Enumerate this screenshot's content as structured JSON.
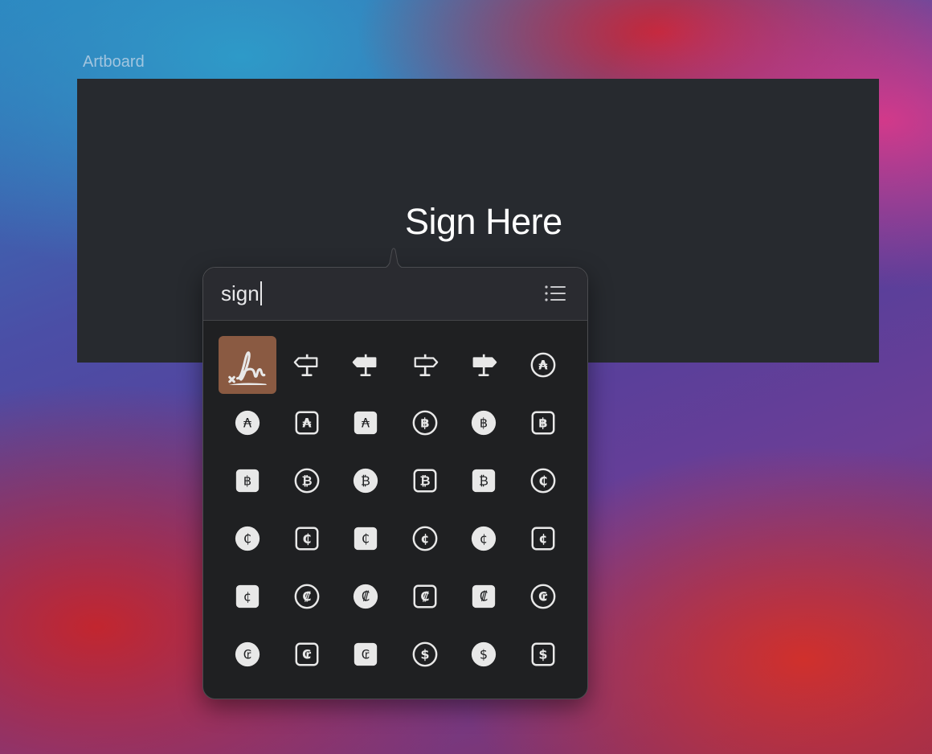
{
  "artboard": {
    "label": "Artboard",
    "text": "Sign Here"
  },
  "search": {
    "value": "sign"
  },
  "colors": {
    "selected_cell": "#8a5a42",
    "glyph": "#e8e8e8",
    "panel": "#1f2022"
  },
  "symbols": [
    {
      "name": "signature",
      "shape": "signature",
      "ch": ""
    },
    {
      "name": "signpost-left",
      "shape": "signpost",
      "dir": "left",
      "fill": false,
      "ch": ""
    },
    {
      "name": "signpost-left-fill",
      "shape": "signpost",
      "dir": "left",
      "fill": true,
      "ch": ""
    },
    {
      "name": "signpost-right",
      "shape": "signpost",
      "dir": "right",
      "fill": false,
      "ch": ""
    },
    {
      "name": "signpost-right-fill",
      "shape": "signpost",
      "dir": "right",
      "fill": true,
      "ch": ""
    },
    {
      "name": "australsign-circle",
      "shape": "circle",
      "fill": false,
      "ch": "₳"
    },
    {
      "name": "australsign-circle-fill",
      "shape": "circle",
      "fill": true,
      "ch": "₳"
    },
    {
      "name": "australsign-square",
      "shape": "square",
      "fill": false,
      "ch": "₳"
    },
    {
      "name": "australsign-square-fill",
      "shape": "square",
      "fill": true,
      "ch": "₳"
    },
    {
      "name": "bahtsign-circle",
      "shape": "circle",
      "fill": false,
      "ch": "฿"
    },
    {
      "name": "bahtsign-circle-fill",
      "shape": "circle",
      "fill": true,
      "ch": "฿"
    },
    {
      "name": "bahtsign-square",
      "shape": "square",
      "fill": false,
      "ch": "฿"
    },
    {
      "name": "bahtsign-square-fill",
      "shape": "square",
      "fill": true,
      "ch": "฿"
    },
    {
      "name": "bitcoinsign-circle",
      "shape": "circle",
      "fill": false,
      "ch": "₿"
    },
    {
      "name": "bitcoinsign-circle-fill",
      "shape": "circle",
      "fill": true,
      "ch": "₿"
    },
    {
      "name": "bitcoinsign-square",
      "shape": "square",
      "fill": false,
      "ch": "₿"
    },
    {
      "name": "bitcoinsign-square-fill",
      "shape": "square",
      "fill": true,
      "ch": "₿"
    },
    {
      "name": "cedisign-circle",
      "shape": "circle",
      "fill": false,
      "ch": "₵"
    },
    {
      "name": "cedisign-circle-fill",
      "shape": "circle",
      "fill": true,
      "ch": "₵"
    },
    {
      "name": "cedisign-square",
      "shape": "square",
      "fill": false,
      "ch": "₵"
    },
    {
      "name": "cedisign-square-fill",
      "shape": "square",
      "fill": true,
      "ch": "₵"
    },
    {
      "name": "centsign-circle",
      "shape": "circle",
      "fill": false,
      "ch": "¢"
    },
    {
      "name": "centsign-circle-fill",
      "shape": "circle",
      "fill": true,
      "ch": "¢"
    },
    {
      "name": "centsign-square",
      "shape": "square",
      "fill": false,
      "ch": "¢"
    },
    {
      "name": "centsign-square-fill",
      "shape": "square",
      "fill": true,
      "ch": "¢"
    },
    {
      "name": "coloncurrencysign-circle",
      "shape": "circle",
      "fill": false,
      "ch": "₡"
    },
    {
      "name": "coloncurrencysign-circle-fill",
      "shape": "circle",
      "fill": true,
      "ch": "₡"
    },
    {
      "name": "coloncurrencysign-square",
      "shape": "square",
      "fill": false,
      "ch": "₡"
    },
    {
      "name": "coloncurrencysign-square-fill",
      "shape": "square",
      "fill": true,
      "ch": "₡"
    },
    {
      "name": "cruzeirosign-circle",
      "shape": "circle",
      "fill": false,
      "ch": "₢"
    },
    {
      "name": "cruzeirosign-circle-fill",
      "shape": "circle",
      "fill": true,
      "ch": "₢"
    },
    {
      "name": "cruzeirosign-square",
      "shape": "square",
      "fill": false,
      "ch": "₢"
    },
    {
      "name": "cruzeirosign-square-fill",
      "shape": "square",
      "fill": true,
      "ch": "₢"
    },
    {
      "name": "dollarsign-circle",
      "shape": "circle",
      "fill": false,
      "ch": "$"
    },
    {
      "name": "dollarsign-circle-fill",
      "shape": "circle",
      "fill": true,
      "ch": "$"
    },
    {
      "name": "dollarsign-square",
      "shape": "square",
      "fill": false,
      "ch": "$"
    }
  ],
  "selected_index": 0
}
